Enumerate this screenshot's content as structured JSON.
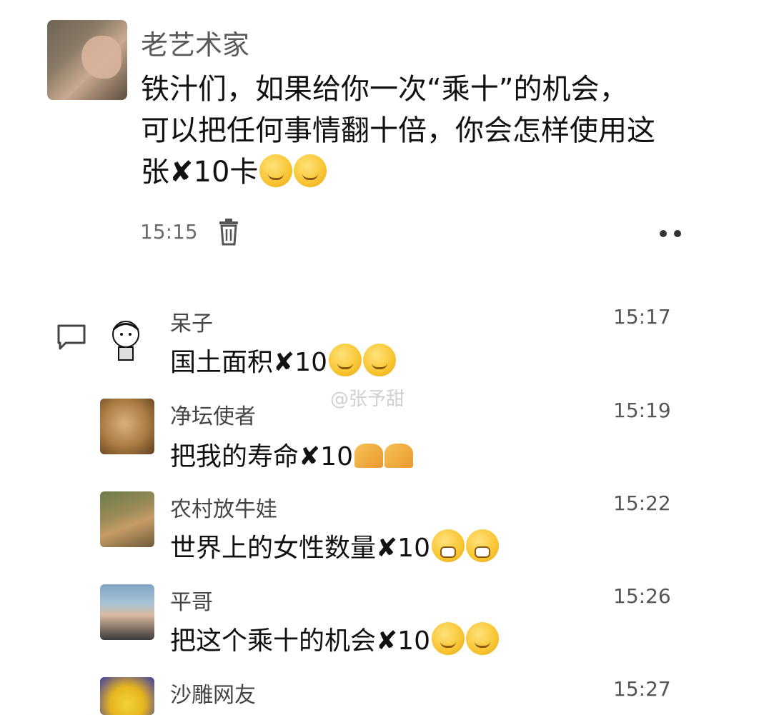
{
  "post": {
    "author": "老艺术家",
    "text_line1": "铁汁们，如果给你一次“乘十”的机会，",
    "text_line2": "可以把任何事情翻十倍，你会怎样使用这",
    "text_line3": "张✘10卡",
    "time": "15:15",
    "emoji_names": [
      "smirk-emoji",
      "smirk-emoji"
    ]
  },
  "watermark": "@张予甜",
  "comments": [
    {
      "name": "呆子",
      "time": "15:17",
      "text": "国土面积✘10",
      "emoji": "smirk"
    },
    {
      "name": "净坛使者",
      "time": "15:19",
      "text": "把我的寿命✘10",
      "emoji": "praying-hands"
    },
    {
      "name": "农村放牛娃",
      "time": "15:22",
      "text": "世界上的女性数量✘10",
      "emoji": "grin"
    },
    {
      "name": "平哥",
      "time": "15:26",
      "text": "把这个乘十的机会✘10",
      "emoji": "smirk"
    },
    {
      "name": "沙雕网友",
      "time": "15:27",
      "text": ""
    }
  ],
  "icons": {
    "trash": "trash-icon",
    "more": "more-dots-icon",
    "comment": "comment-bubble-icon"
  }
}
